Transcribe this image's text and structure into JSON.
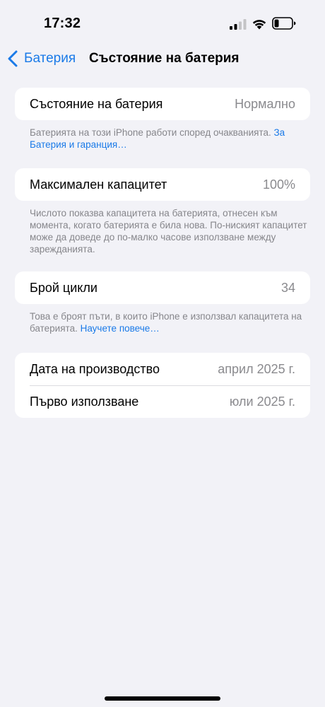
{
  "status": {
    "time": "17:32"
  },
  "nav": {
    "back_label": "Батерия",
    "title": "Състояние на батерия"
  },
  "groups": {
    "health": {
      "label": "Състояние на батерия",
      "value": "Нормално",
      "footer_text": "Батерията на този iPhone работи според очакванията. ",
      "footer_link": "За Батерия и гаранция…"
    },
    "capacity": {
      "label": "Максимален капацитет",
      "value": "100%",
      "footer_text": "Числото показва капацитета на батерията, отнесен към момента, когато батерията е била нова. По-ниският капацитет може да доведе до по-малко часове използване между зарежданията."
    },
    "cycles": {
      "label": "Брой цикли",
      "value": "34",
      "footer_text": "Това е броят пъти, в които iPhone е използвал капацитета на батерията. ",
      "footer_link": "Научете повече…"
    },
    "dates": {
      "manufacture_label": "Дата на производство",
      "manufacture_value": "април 2025 г.",
      "first_use_label": "Първо използване",
      "first_use_value": "юли 2025 г."
    }
  },
  "colors": {
    "accent": "#1a7ae8",
    "background": "#f2f2f7",
    "secondary_text": "#86868b"
  }
}
